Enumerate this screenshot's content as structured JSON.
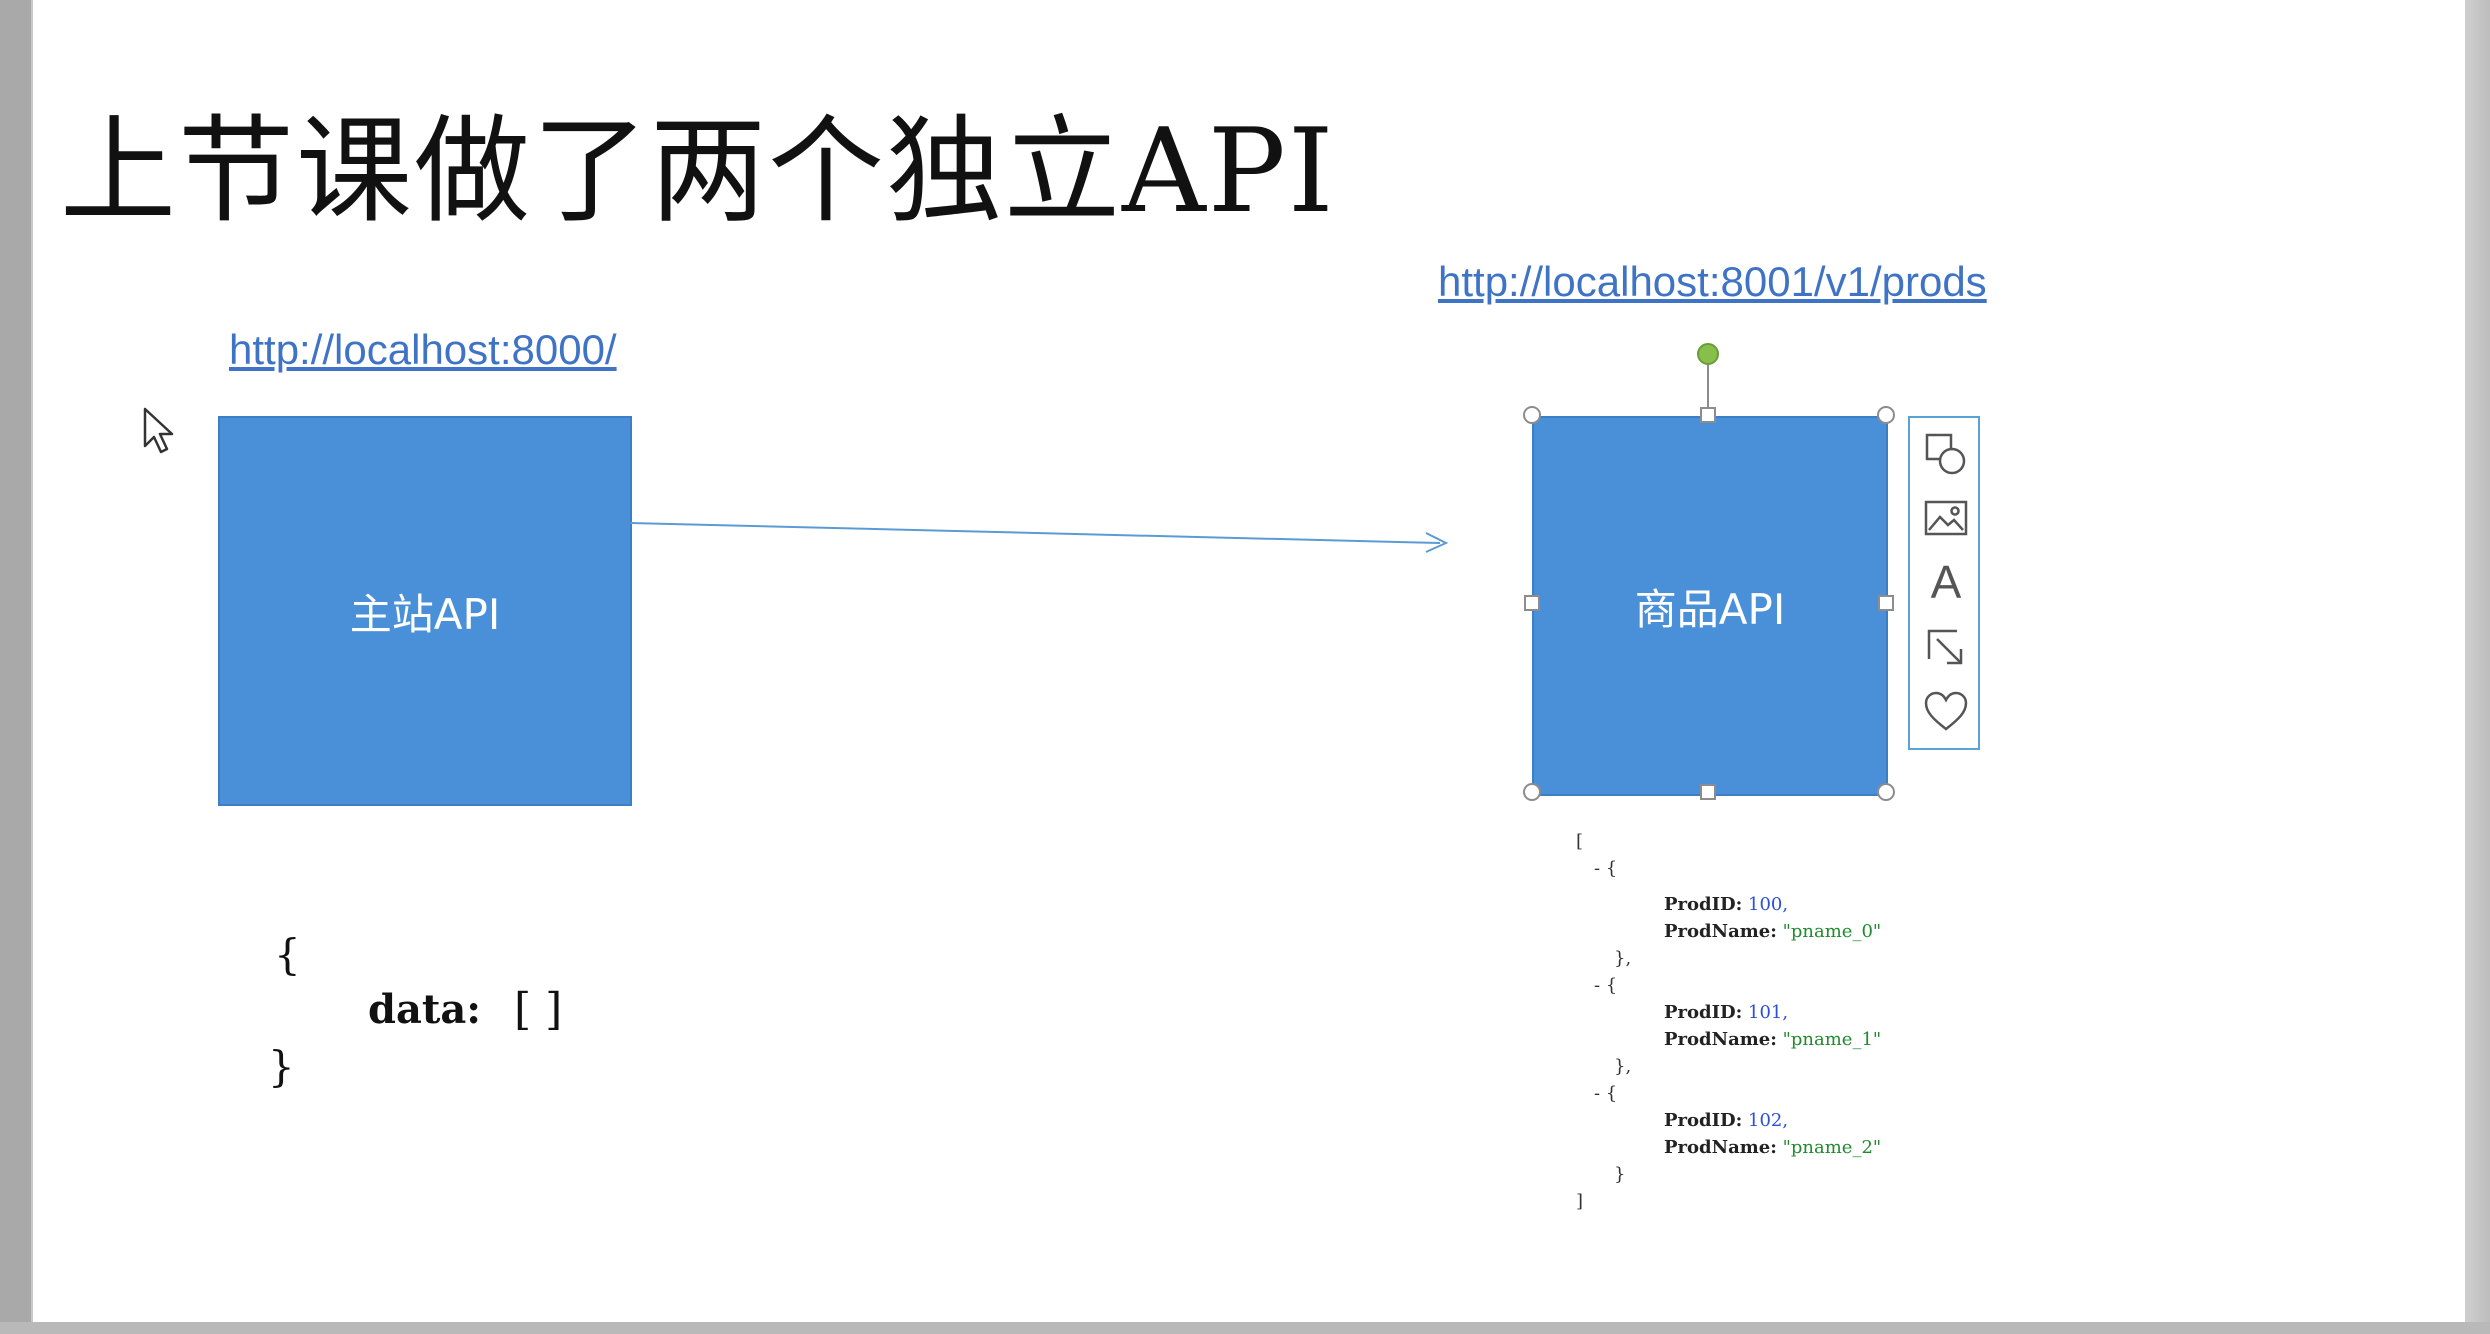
{
  "slide": {
    "title": "上节课做了两个独立API",
    "left_service": {
      "url": "http://localhost:8000/",
      "box_label": "主站API",
      "json_open": "{",
      "json_key": "data:",
      "json_value": "[ ]",
      "json_close": "}"
    },
    "right_service": {
      "url": "http://localhost:8001/v1/prods",
      "box_label": "商品API",
      "json": {
        "open_bracket": "[",
        "close_bracket": "]",
        "item_open": "- {",
        "item_close": "},",
        "last_close": "}",
        "items": [
          {
            "id_key": "ProdID:",
            "id_value": "100,",
            "name_key": "ProdName:",
            "name_value": "\"pname_0\""
          },
          {
            "id_key": "ProdID:",
            "id_value": "101,",
            "name_key": "ProdName:",
            "name_value": "\"pname_1\""
          },
          {
            "id_key": "ProdID:",
            "id_value": "102,",
            "name_key": "ProdName:",
            "name_value": "\"pname_2\""
          }
        ]
      }
    }
  },
  "toolbar": {
    "icons": [
      "shapes-icon",
      "image-icon",
      "text-icon",
      "link-arrow-icon",
      "heart-icon"
    ],
    "text_icon_glyph": "A"
  },
  "colors": {
    "box_fill": "#4a90d9",
    "link": "#3f73c6",
    "arrow": "#5b9bd5",
    "selection_border": "#5aa1d6",
    "rotate_handle": "#86c04a"
  }
}
